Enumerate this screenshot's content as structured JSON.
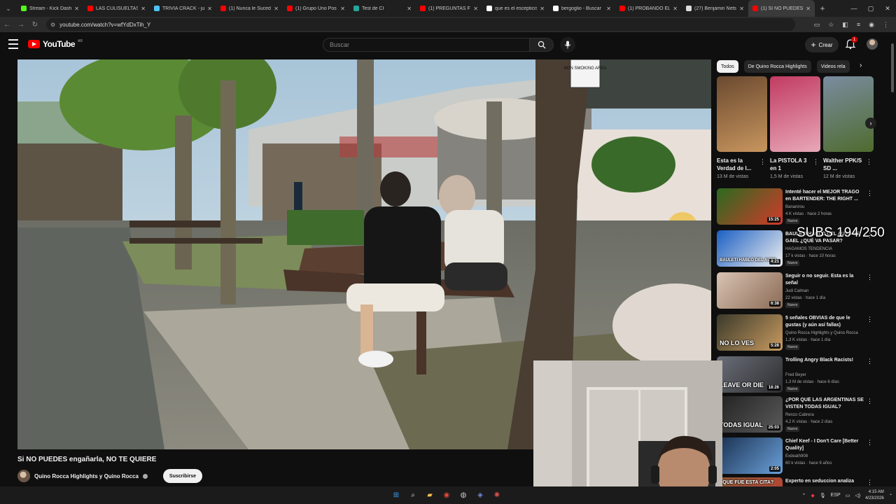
{
  "browser": {
    "tabs": [
      {
        "label": "Stream - Kick Dash",
        "color": "#53fc18"
      },
      {
        "label": "LAS CULISUELTAS",
        "color": "#ff0000"
      },
      {
        "label": "TRIVIA CRACK - jug",
        "color": "#4fc3f7"
      },
      {
        "label": "(1) Nunca le Suced",
        "color": "#ff0000"
      },
      {
        "label": "(1) Grupo Uno Pos",
        "color": "#ff0000"
      },
      {
        "label": "Test de CI",
        "color": "#26a69a"
      },
      {
        "label": "(1) PREGUNTAS FÁ",
        "color": "#ff0000"
      },
      {
        "label": "que es el escepticis",
        "color": "#ffffff"
      },
      {
        "label": "bergoglio - Buscar",
        "color": "#ffffff"
      },
      {
        "label": "(1) PROBANDO EL",
        "color": "#ff0000"
      },
      {
        "label": "(27) Benjamin Nets",
        "color": "#dddddd"
      },
      {
        "label": "(1) SI NO PUEDES",
        "color": "#ff0000"
      }
    ],
    "url": "youtube.com/watch?v=wfYdDxTih_Y"
  },
  "header": {
    "logo_text": "YouTube",
    "country_code": "AR",
    "search_placeholder": "Buscar",
    "create_label": "Crear",
    "notification_count": "1"
  },
  "video": {
    "title": "Si NO PUEDES engañarla, NO TE QUIERE",
    "channel": "Quino Rocca Highlights y Quino Rocca",
    "subscribe_label": "Suscribirse",
    "sign_text": "NON SMOKING AREA"
  },
  "sidebar": {
    "chips": [
      "Todos",
      "De Quino Rocca Highlights",
      "Videos rela"
    ],
    "shorts": [
      {
        "title": "Esta es la Verdad de l...",
        "views": "13 M de vistas",
        "colors": [
          "#6b4a30",
          "#c8955e"
        ]
      },
      {
        "title": "La PISTOLA 3 en 1",
        "views": "1,5 M de vistas",
        "colors": [
          "#c23b62",
          "#e8a8b8"
        ]
      },
      {
        "title": "Walther PPK/S SD ...",
        "views": "12 M de vistas",
        "colors": [
          "#7a8ca0",
          "#4f6b2e"
        ]
      }
    ],
    "recommended": [
      {
        "title": "Intenté hacer el MEJOR TRAGO en BARTENDER: THE RIGHT ...",
        "channel": "Bananirou",
        "meta": "4 K vistas · hace 2 horas",
        "badge": "Nuevo",
        "duration": "15:25",
        "overlay": "",
        "colors": [
          "#2a6b1f",
          "#d23a2a"
        ]
      },
      {
        "title": "BAULETI HABLÓ DEL AUTO DE GAEL ¿QUÉ VA PASAR?",
        "channel": "HAGAMOS TENDENCIA",
        "meta": "17 k vistas · hace 10 horas",
        "badge": "Nuevo",
        "duration": "4:21",
        "overlay": "BAULETI HABLÓ DEL AUTO",
        "colors": [
          "#1b5fc4",
          "#eeeeee"
        ]
      },
      {
        "title": "Seguir o no seguir. Esta es la señal",
        "channel": "Judi Calman",
        "meta": "22 vistas · hace 1 día",
        "badge": "Nuevo",
        "duration": "6:38",
        "overlay": "",
        "colors": [
          "#d9c4b3",
          "#8a6a55"
        ]
      },
      {
        "title": "5 señales OBVIAS de que le gustas (y aún así fallas)",
        "channel": "Quino Rocca Highlights y Quino Rocca",
        "meta": "1,3 K vistas · hace 1 día",
        "badge": "Nuevo",
        "duration": "5:28",
        "overlay": "NO LO VES",
        "colors": [
          "#3a3a2a",
          "#c89a60"
        ]
      },
      {
        "title": "Trolling Angry Black Racists!",
        "channel": "Fred Beyer",
        "meta": "1,3 M de vistas · hace 6 días",
        "badge": "Nuevo",
        "duration": "18:26",
        "overlay": "LEAVE OR DIE",
        "colors": [
          "#6a6e78",
          "#2e2e30"
        ]
      },
      {
        "title": "¿POR QUÉ LAS ARGENTINAS SE VISTEN TODAS IGUAL?",
        "channel": "Renzo Cabrera",
        "meta": "4,2 K vistas · hace 2 días",
        "badge": "Nuevo",
        "duration": "25:03",
        "overlay": "TODAS   IGUAL",
        "colors": [
          "#222222",
          "#5a5a5a"
        ]
      },
      {
        "title": "Chief Keef - I Don't Care [Better Quality]",
        "channel": "Exdeath908",
        "meta": "60 k vistas · hace 9 años",
        "badge": "",
        "duration": "2:05",
        "overlay": "",
        "colors": [
          "#1a3050",
          "#6aa0d8"
        ]
      },
      {
        "title": "Experto en seduccion analiza",
        "channel": "",
        "meta": "",
        "badge": "",
        "duration": "",
        "overlay": "¿QUE FUE ESTA CITA?",
        "colors": [
          "#8a5a3a",
          "#c04030"
        ]
      }
    ]
  },
  "stream_overlay": {
    "subs_text": "SUBS 194/250"
  },
  "taskbar": {
    "language": "ESP",
    "time": "4:15 AM",
    "date": "4/23/2026"
  }
}
